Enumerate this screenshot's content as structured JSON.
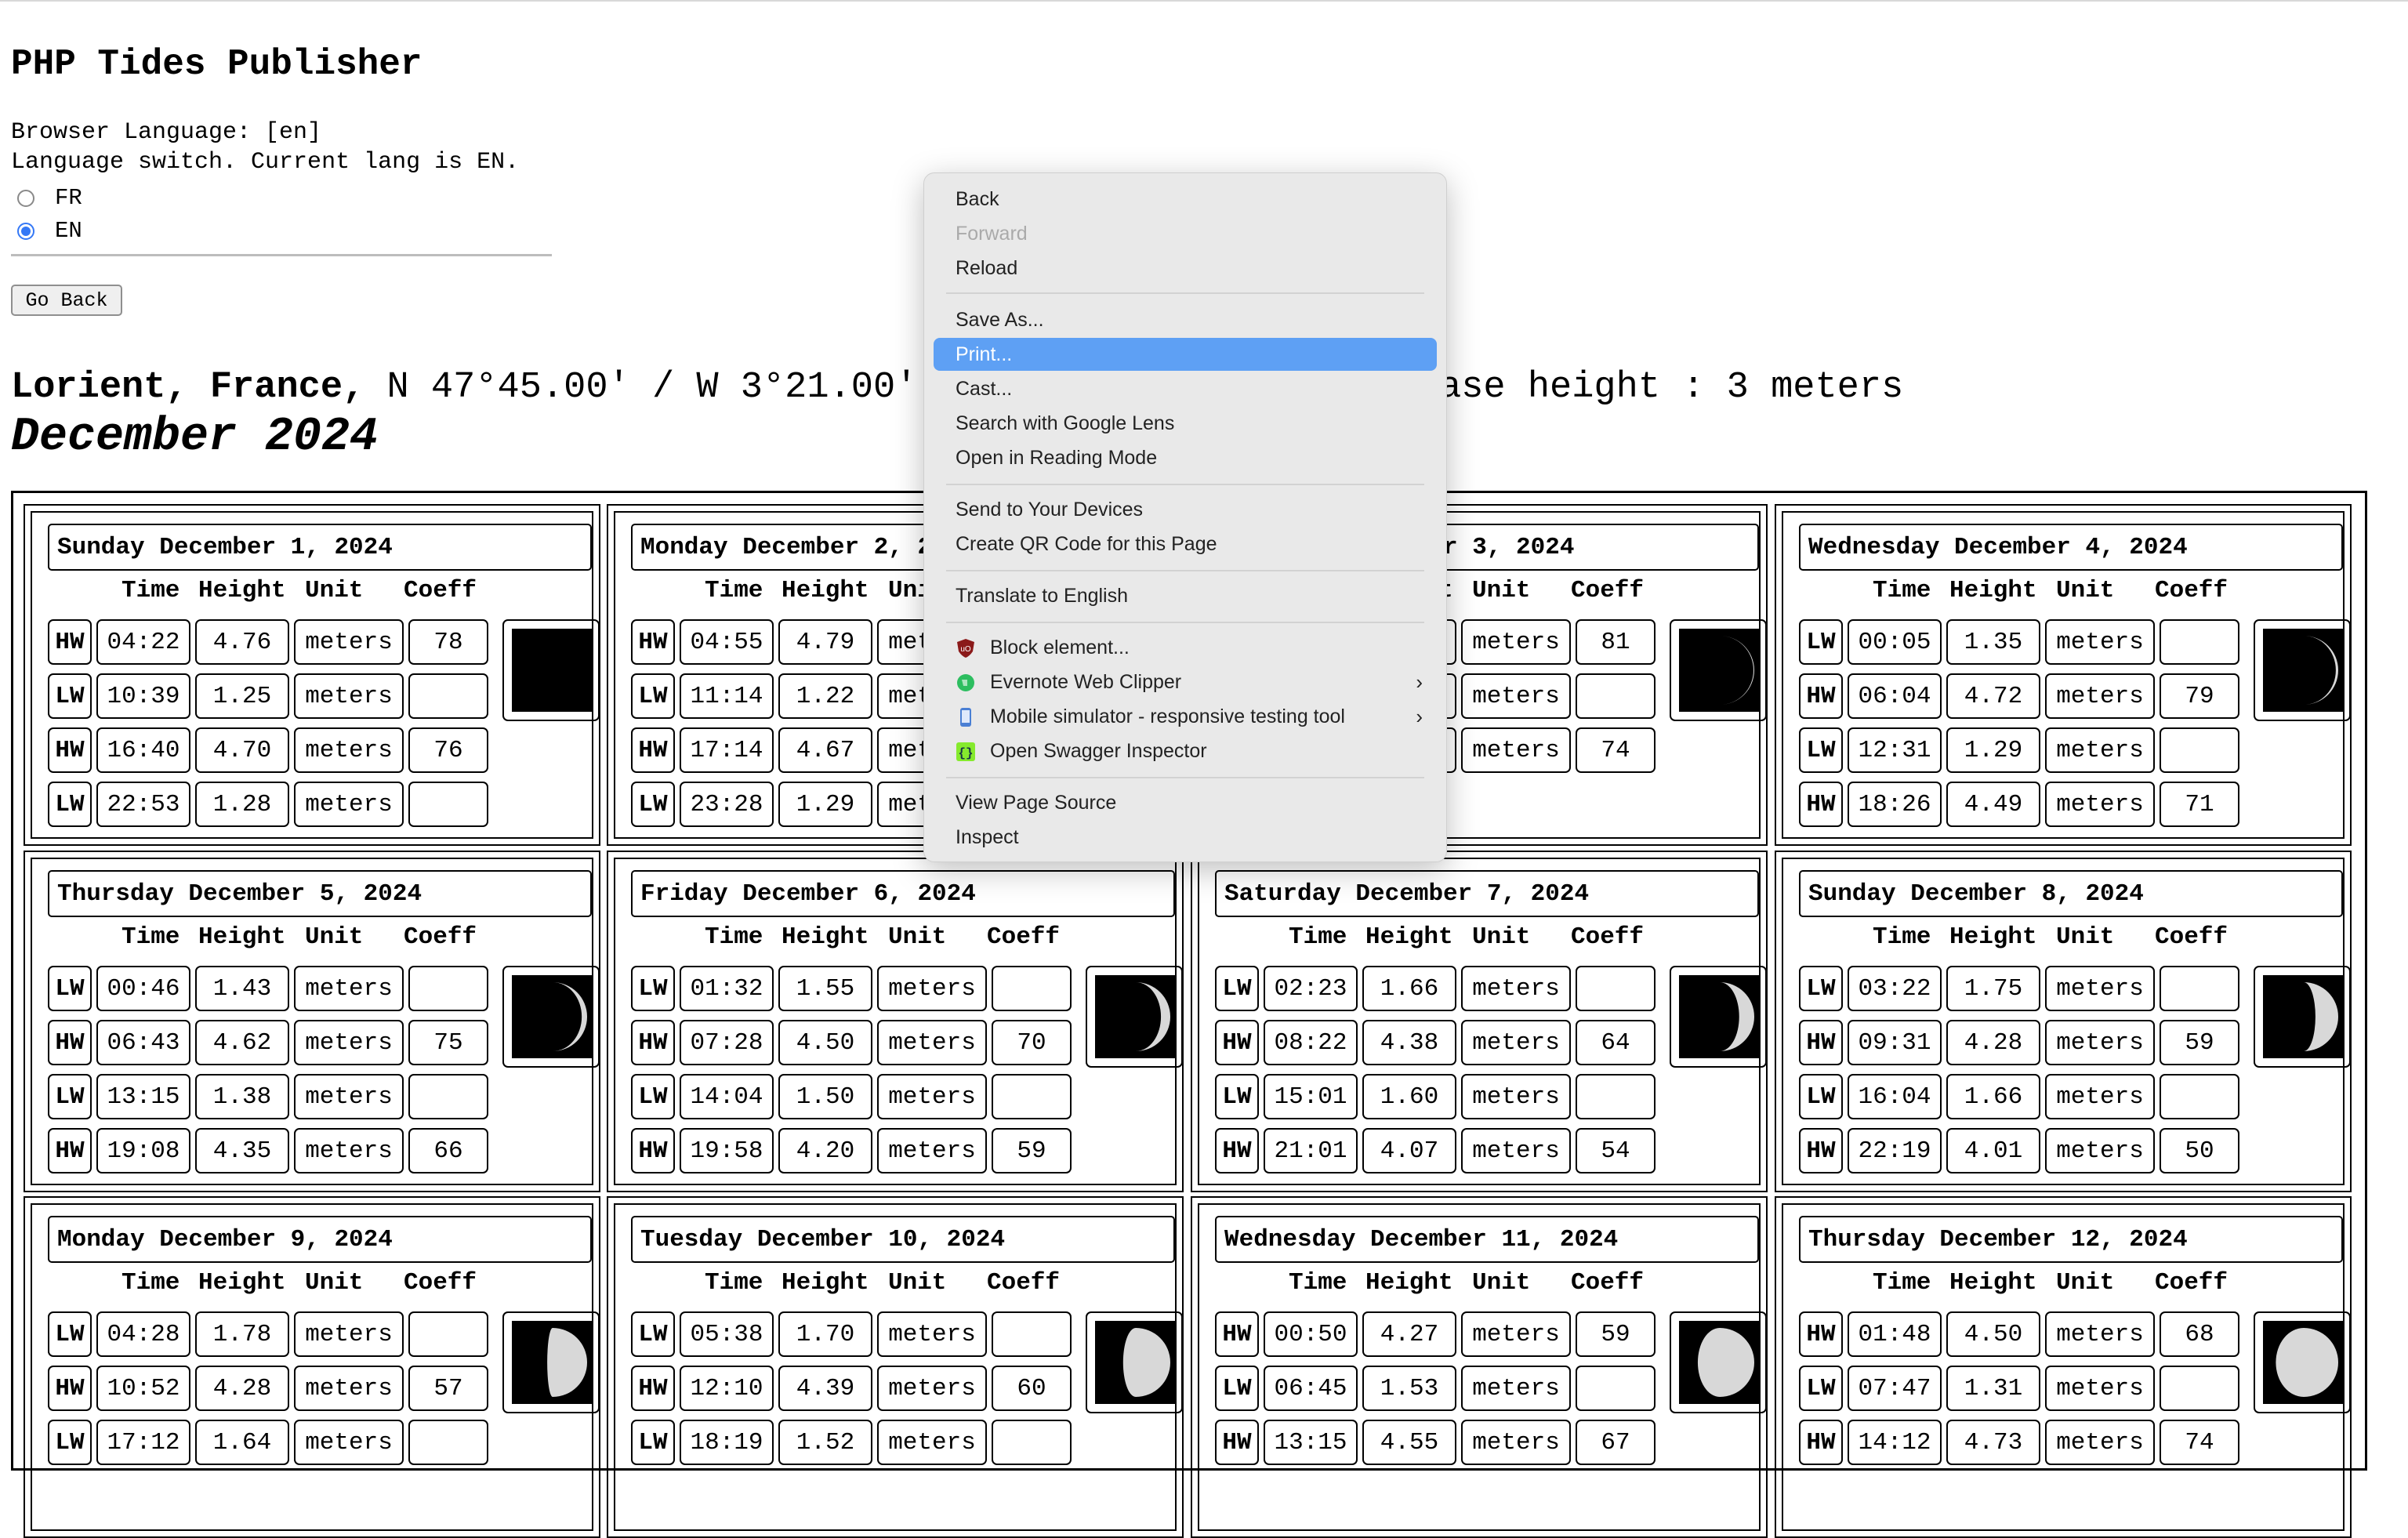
{
  "page": {
    "title": "PHP Tides Publisher",
    "browser_language": "Browser Language: [en]",
    "language_switch": "Language switch. Current lang is EN.",
    "lang_options": [
      "FR",
      "EN"
    ],
    "selected_lang": "EN",
    "go_back_label": "Go Back",
    "location_name": "Lorient, France,",
    "location_coords": " N 47°45.00' / W 3°21.00'",
    "location_base": "ase height : 3 meters",
    "month_title": "December 2024"
  },
  "table_headers": {
    "time": "Time",
    "height": "Height",
    "unit": "Unit",
    "coeff": "Coeff"
  },
  "days": [
    {
      "title": "Sunday December 1, 2024",
      "moon": 0.0,
      "rows": [
        {
          "type": "HW",
          "time": "04:22",
          "height": "4.76",
          "unit": "meters",
          "coeff": "78"
        },
        {
          "type": "LW",
          "time": "10:39",
          "height": "1.25",
          "unit": "meters",
          "coeff": ""
        },
        {
          "type": "HW",
          "time": "16:40",
          "height": "4.70",
          "unit": "meters",
          "coeff": "76"
        },
        {
          "type": "LW",
          "time": "22:53",
          "height": "1.28",
          "unit": "meters",
          "coeff": ""
        }
      ]
    },
    {
      "title": "Monday December 2, 2024",
      "moon": 0.03,
      "rows": [
        {
          "type": "HW",
          "time": "04:55",
          "height": "4.79",
          "unit": "meters",
          "coeff": ""
        },
        {
          "type": "LW",
          "time": "11:14",
          "height": "1.22",
          "unit": "meters",
          "coeff": ""
        },
        {
          "type": "HW",
          "time": "17:14",
          "height": "4.67",
          "unit": "meters",
          "coeff": ""
        },
        {
          "type": "LW",
          "time": "23:28",
          "height": "1.29",
          "unit": "meters",
          "coeff": ""
        }
      ]
    },
    {
      "title": "Tuesday December 3, 2024",
      "moon": 0.07,
      "rows": [
        {
          "type": "",
          "time": "",
          "height": "",
          "unit": "meters",
          "coeff": "81"
        },
        {
          "type": "",
          "time": "",
          "height": "",
          "unit": "meters",
          "coeff": ""
        },
        {
          "type": "",
          "time": "",
          "height": "",
          "unit": "meters",
          "coeff": "74"
        }
      ]
    },
    {
      "title": "Wednesday December 4, 2024",
      "moon": 0.12,
      "rows": [
        {
          "type": "LW",
          "time": "00:05",
          "height": "1.35",
          "unit": "meters",
          "coeff": ""
        },
        {
          "type": "HW",
          "time": "06:04",
          "height": "4.72",
          "unit": "meters",
          "coeff": "79"
        },
        {
          "type": "LW",
          "time": "12:31",
          "height": "1.29",
          "unit": "meters",
          "coeff": ""
        },
        {
          "type": "HW",
          "time": "18:26",
          "height": "4.49",
          "unit": "meters",
          "coeff": "71"
        }
      ]
    },
    {
      "title": "Thursday December 5, 2024",
      "moon": 0.18,
      "rows": [
        {
          "type": "LW",
          "time": "00:46",
          "height": "1.43",
          "unit": "meters",
          "coeff": ""
        },
        {
          "type": "HW",
          "time": "06:43",
          "height": "4.62",
          "unit": "meters",
          "coeff": "75"
        },
        {
          "type": "LW",
          "time": "13:15",
          "height": "1.38",
          "unit": "meters",
          "coeff": ""
        },
        {
          "type": "HW",
          "time": "19:08",
          "height": "4.35",
          "unit": "meters",
          "coeff": "66"
        }
      ]
    },
    {
      "title": "Friday December 6, 2024",
      "moon": 0.24,
      "rows": [
        {
          "type": "LW",
          "time": "01:32",
          "height": "1.55",
          "unit": "meters",
          "coeff": ""
        },
        {
          "type": "HW",
          "time": "07:28",
          "height": "4.50",
          "unit": "meters",
          "coeff": "70"
        },
        {
          "type": "LW",
          "time": "14:04",
          "height": "1.50",
          "unit": "meters",
          "coeff": ""
        },
        {
          "type": "HW",
          "time": "19:58",
          "height": "4.20",
          "unit": "meters",
          "coeff": "59"
        }
      ]
    },
    {
      "title": "Saturday December 7, 2024",
      "moon": 0.31,
      "rows": [
        {
          "type": "LW",
          "time": "02:23",
          "height": "1.66",
          "unit": "meters",
          "coeff": ""
        },
        {
          "type": "HW",
          "time": "08:22",
          "height": "4.38",
          "unit": "meters",
          "coeff": "64"
        },
        {
          "type": "LW",
          "time": "15:01",
          "height": "1.60",
          "unit": "meters",
          "coeff": ""
        },
        {
          "type": "HW",
          "time": "21:01",
          "height": "4.07",
          "unit": "meters",
          "coeff": "54"
        }
      ]
    },
    {
      "title": "Sunday December 8, 2024",
      "moon": 0.39,
      "rows": [
        {
          "type": "LW",
          "time": "03:22",
          "height": "1.75",
          "unit": "meters",
          "coeff": ""
        },
        {
          "type": "HW",
          "time": "09:31",
          "height": "4.28",
          "unit": "meters",
          "coeff": "59"
        },
        {
          "type": "LW",
          "time": "16:04",
          "height": "1.66",
          "unit": "meters",
          "coeff": ""
        },
        {
          "type": "HW",
          "time": "22:19",
          "height": "4.01",
          "unit": "meters",
          "coeff": "50"
        }
      ]
    },
    {
      "title": "Monday December 9, 2024",
      "moon": 0.55,
      "rows": [
        {
          "type": "LW",
          "time": "04:28",
          "height": "1.78",
          "unit": "meters",
          "coeff": ""
        },
        {
          "type": "HW",
          "time": "10:52",
          "height": "4.28",
          "unit": "meters",
          "coeff": "57"
        },
        {
          "type": "LW",
          "time": "17:12",
          "height": "1.64",
          "unit": "meters",
          "coeff": ""
        }
      ]
    },
    {
      "title": "Tuesday December 10, 2024",
      "moon": 0.62,
      "rows": [
        {
          "type": "LW",
          "time": "05:38",
          "height": "1.70",
          "unit": "meters",
          "coeff": ""
        },
        {
          "type": "HW",
          "time": "12:10",
          "height": "4.39",
          "unit": "meters",
          "coeff": "60"
        },
        {
          "type": "LW",
          "time": "18:19",
          "height": "1.52",
          "unit": "meters",
          "coeff": ""
        }
      ]
    },
    {
      "title": "Wednesday December 11, 2024",
      "moon": 0.72,
      "rows": [
        {
          "type": "HW",
          "time": "00:50",
          "height": "4.27",
          "unit": "meters",
          "coeff": "59"
        },
        {
          "type": "LW",
          "time": "06:45",
          "height": "1.53",
          "unit": "meters",
          "coeff": ""
        },
        {
          "type": "HW",
          "time": "13:15",
          "height": "4.55",
          "unit": "meters",
          "coeff": "67"
        }
      ]
    },
    {
      "title": "Thursday December 12, 2024",
      "moon": 0.8,
      "rows": [
        {
          "type": "HW",
          "time": "01:48",
          "height": "4.50",
          "unit": "meters",
          "coeff": "68"
        },
        {
          "type": "LW",
          "time": "07:47",
          "height": "1.31",
          "unit": "meters",
          "coeff": ""
        },
        {
          "type": "HW",
          "time": "14:12",
          "height": "4.73",
          "unit": "meters",
          "coeff": "74"
        }
      ]
    }
  ],
  "context_menu": {
    "items": [
      {
        "label": "Back",
        "state": "normal",
        "icon": ""
      },
      {
        "label": "Forward",
        "state": "disabled",
        "icon": ""
      },
      {
        "label": "Reload",
        "state": "normal",
        "icon": ""
      },
      {
        "label": "Save As...",
        "state": "normal",
        "icon": ""
      },
      {
        "label": "Print...",
        "state": "highlighted",
        "icon": ""
      },
      {
        "label": "Cast...",
        "state": "normal",
        "icon": ""
      },
      {
        "label": "Search with Google Lens",
        "state": "normal",
        "icon": ""
      },
      {
        "label": "Open in Reading Mode",
        "state": "normal",
        "icon": ""
      },
      {
        "label": "Send to Your Devices",
        "state": "normal",
        "icon": ""
      },
      {
        "label": "Create QR Code for this Page",
        "state": "normal",
        "icon": ""
      },
      {
        "label": "Translate to English",
        "state": "normal",
        "icon": ""
      },
      {
        "label": "Block element...",
        "state": "normal",
        "icon": "ublock-shield-icon"
      },
      {
        "label": "Evernote Web Clipper",
        "state": "normal",
        "icon": "evernote-elephant-icon",
        "submenu": true
      },
      {
        "label": "Mobile simulator - responsive testing tool",
        "state": "normal",
        "icon": "mobile-simulator-icon",
        "submenu": true
      },
      {
        "label": "Open Swagger Inspector",
        "state": "normal",
        "icon": "swagger-braces-icon"
      },
      {
        "label": "View Page Source",
        "state": "normal",
        "icon": ""
      },
      {
        "label": "Inspect",
        "state": "normal",
        "icon": ""
      }
    ],
    "highlight_color": "#5ea0f4"
  }
}
